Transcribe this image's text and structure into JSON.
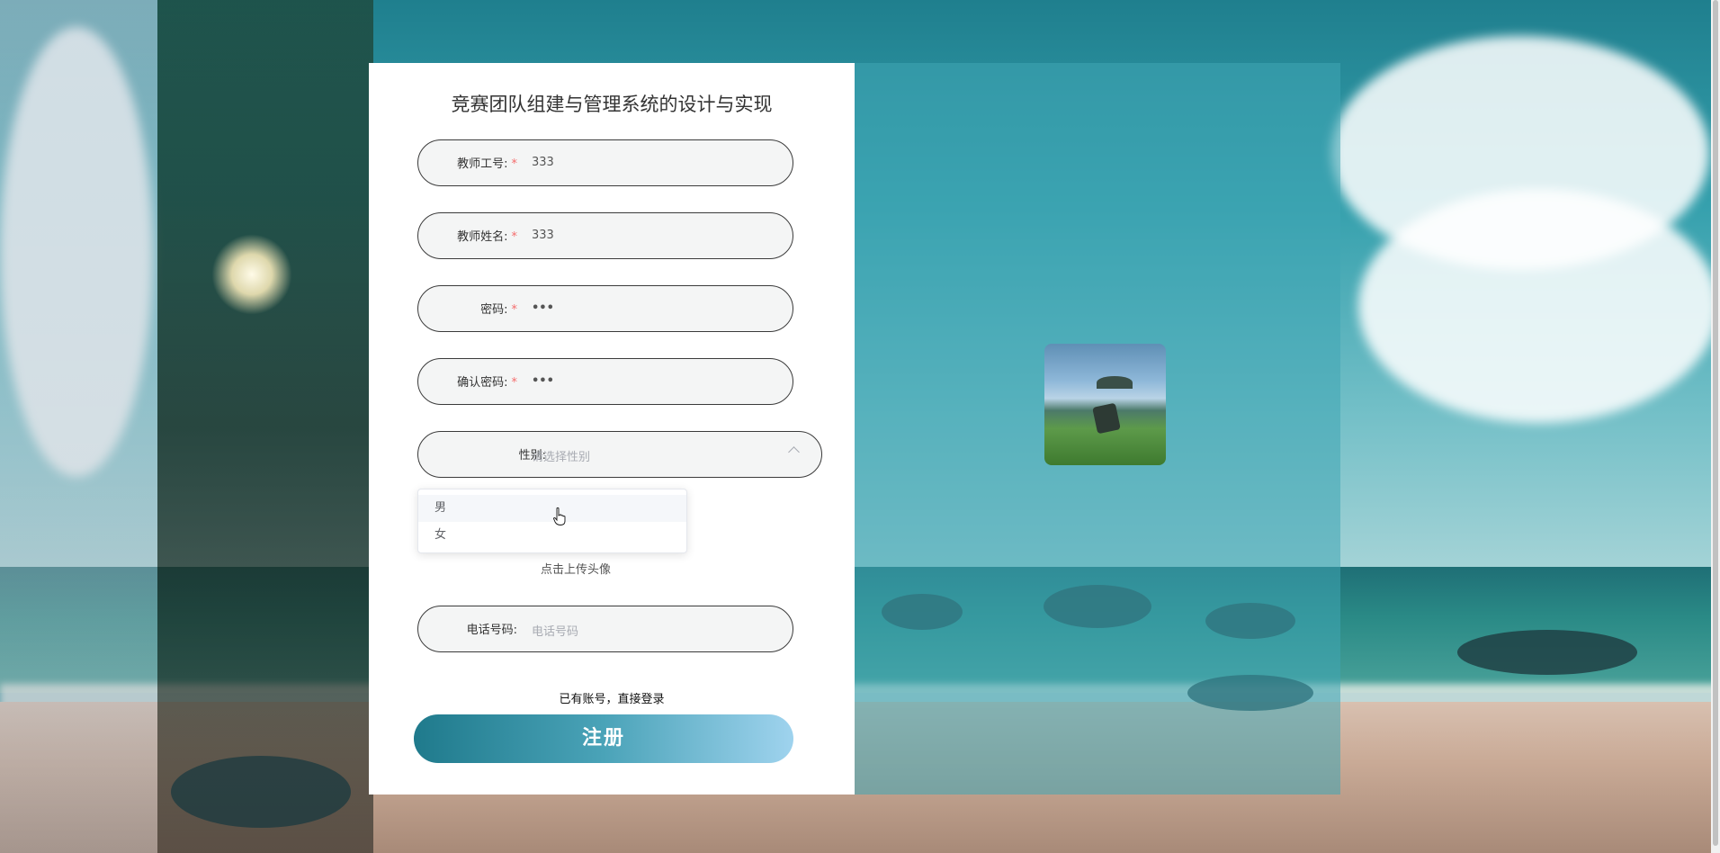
{
  "form": {
    "title": "竞赛团队组建与管理系统的设计与实现",
    "fields": [
      {
        "label": "教师工号:",
        "required": true,
        "value": "333"
      },
      {
        "label": "教师姓名:",
        "required": true,
        "value": "333"
      },
      {
        "label": "密码:",
        "required": true,
        "value": "•••"
      },
      {
        "label": "确认密码:",
        "required": true,
        "value": "•••"
      }
    ],
    "gender": {
      "label": "性别:",
      "placeholder": "请选择性别",
      "options": [
        "男",
        "女"
      ],
      "hovered": "男"
    },
    "upload_tip": "点击上传头像",
    "phone": {
      "label": "电话号码:",
      "placeholder": "电话号码"
    },
    "login_link": "已有账号，直接登录",
    "register_button": "注册",
    "required_mark": "*"
  },
  "colors": {
    "accent_start": "#1f7a8c",
    "accent_end": "#9fd3ee",
    "required": "#f56c6c"
  }
}
